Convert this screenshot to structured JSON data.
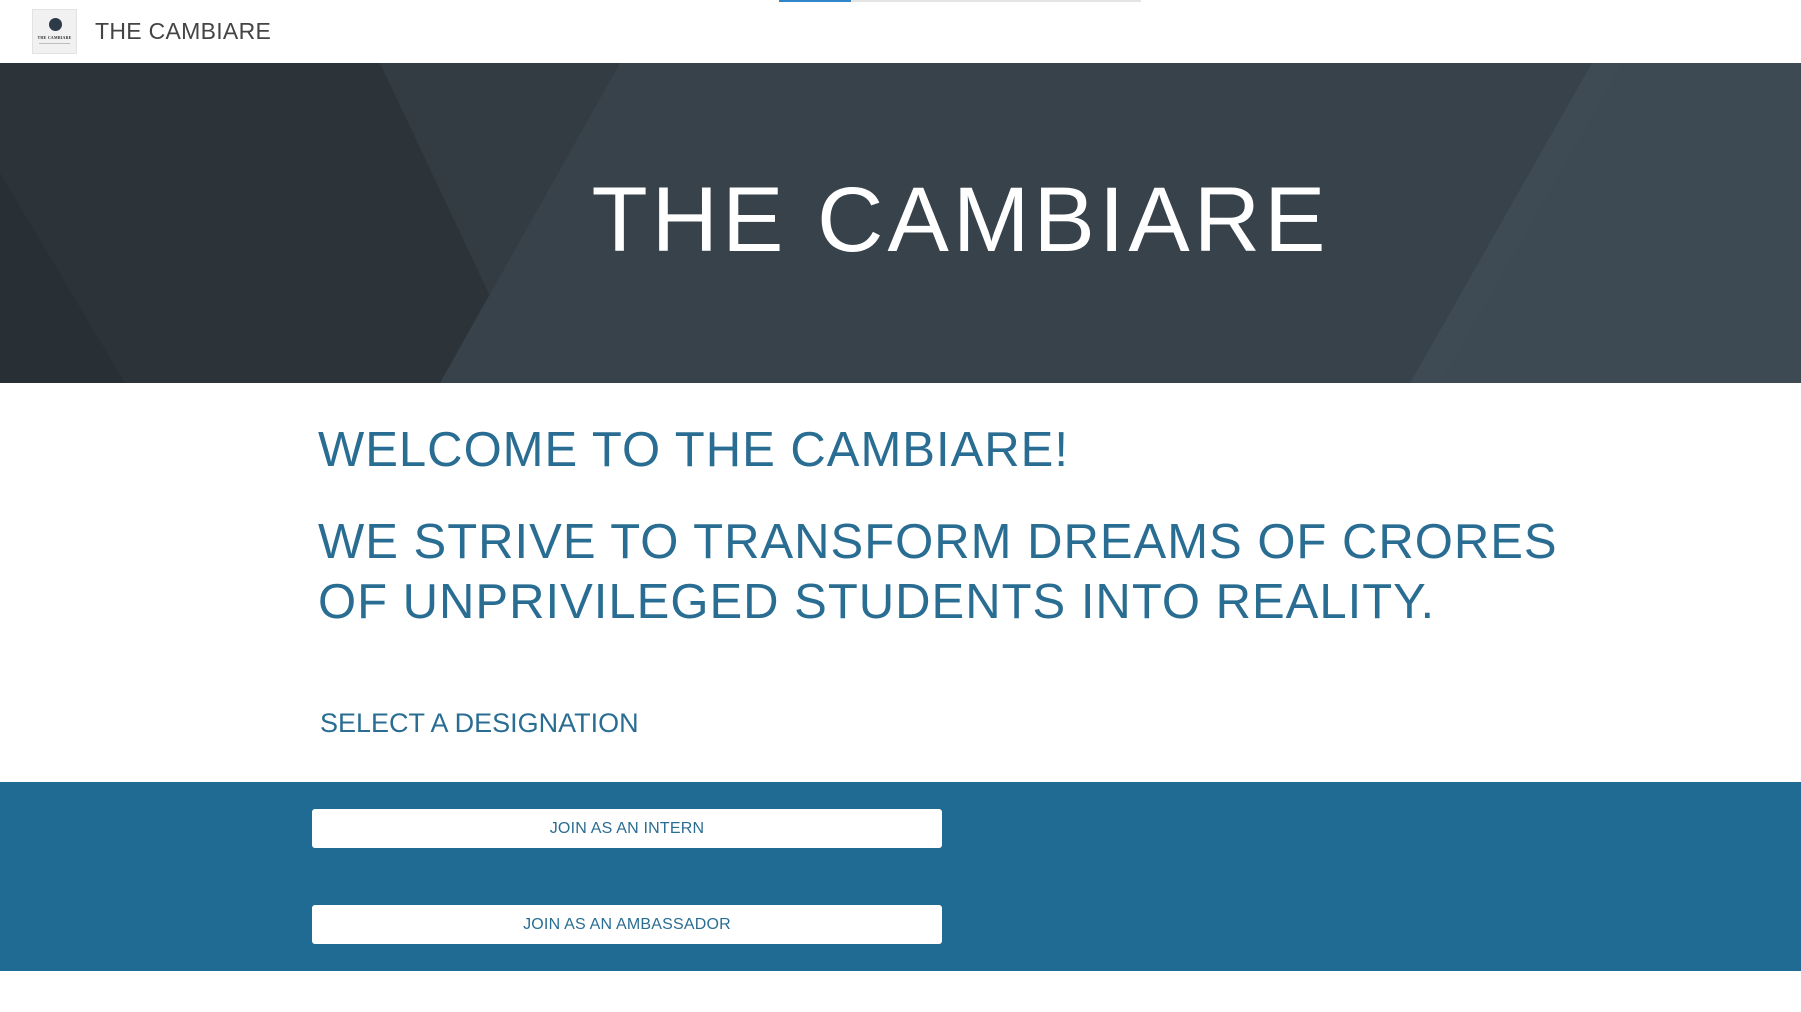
{
  "header": {
    "site_title": "THE CAMBIARE",
    "logo": {
      "text": "THE CAMBIARE",
      "icon": "globe-icon"
    },
    "progress": 0.2
  },
  "hero": {
    "title": "THE CAMBIARE"
  },
  "main": {
    "welcome": "WELCOME TO THE CAMBIARE!",
    "mission": "WE STRIVE TO TRANSFORM DREAMS OF CRORES OF UNPRIVILEGED STUDENTS INTO REALITY.",
    "select_label": "SELECT A DESIGNATION"
  },
  "designations": {
    "intern_label": "JOIN AS AN INTERN",
    "ambassador_label": "JOIN AS AN AMBASSADOR"
  },
  "colors": {
    "accent": "#1f6b93",
    "heading_text": "#2a6d92",
    "hero_background": "#333c44",
    "progress": "#2f86c9"
  }
}
